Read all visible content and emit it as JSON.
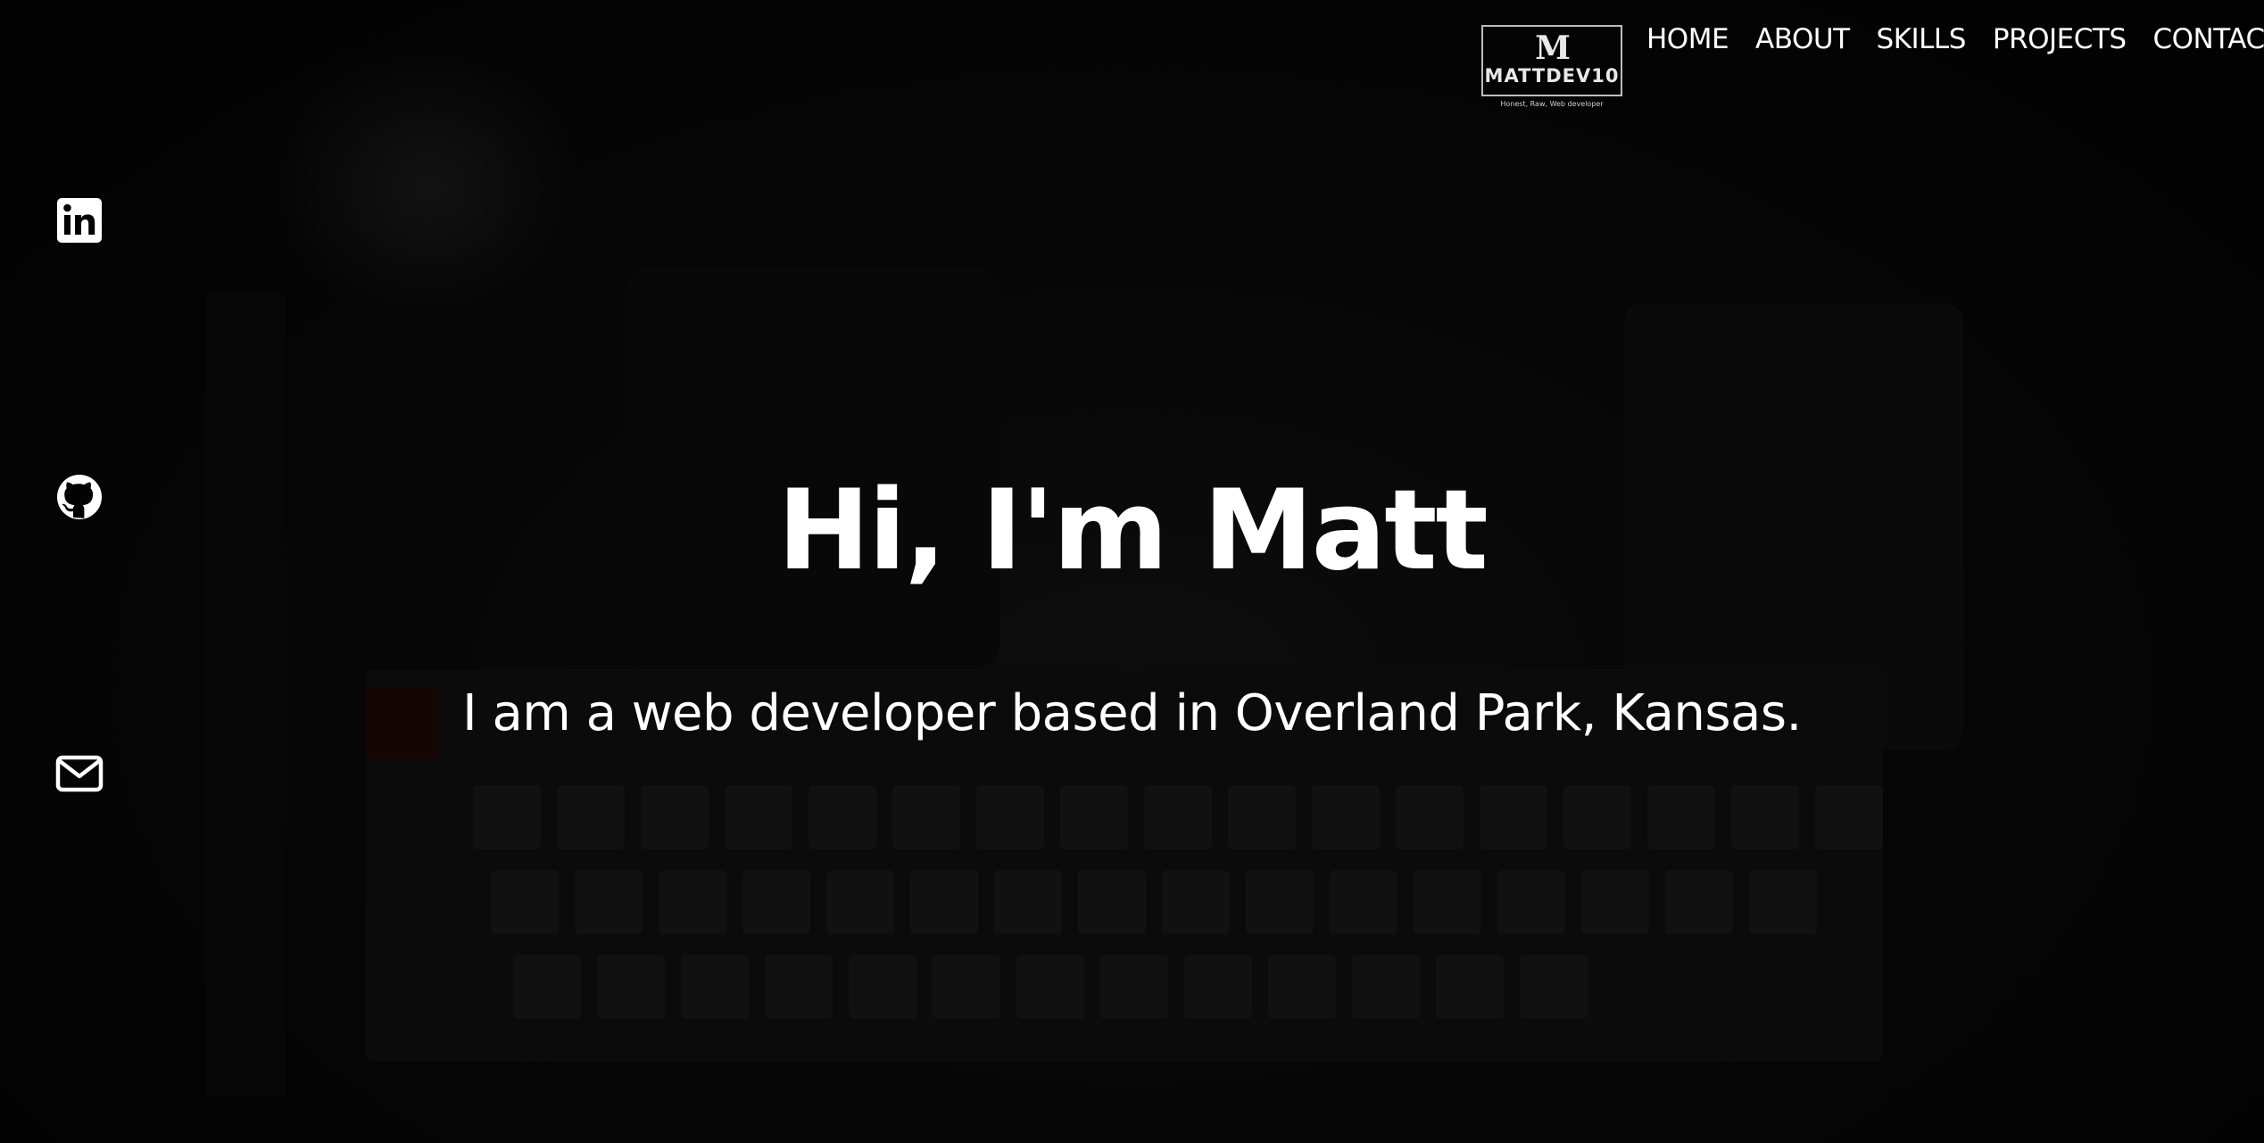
{
  "header": {
    "logo": {
      "mark": "M",
      "name": "MATTDEV10",
      "tagline": "Honest, Raw, Web developer"
    },
    "nav": {
      "items": [
        {
          "label": "HOME"
        },
        {
          "label": "ABOUT"
        },
        {
          "label": "SKILLS"
        },
        {
          "label": "PROJECTS"
        },
        {
          "label": "CONTACT"
        }
      ]
    }
  },
  "social": {
    "icons": [
      {
        "name": "linkedin-icon"
      },
      {
        "name": "github-icon"
      },
      {
        "name": "mail-icon"
      }
    ]
  },
  "hero": {
    "title": "Hi, I'm Matt",
    "subtitle": "I am a web developer based in Overland Park, Kansas."
  },
  "colors": {
    "background": "#030303",
    "text": "#ffffff",
    "logo_border": "#bdbdbd"
  }
}
